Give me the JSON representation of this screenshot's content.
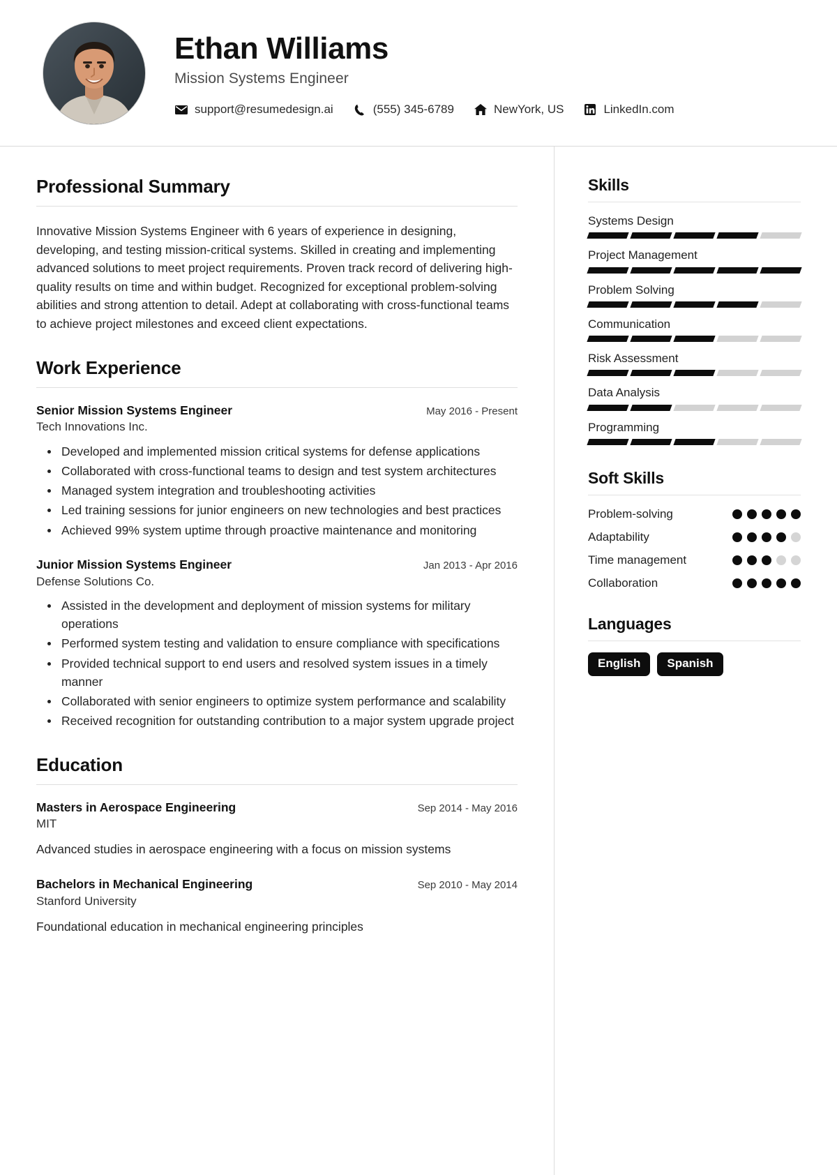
{
  "header": {
    "name": "Ethan Williams",
    "job_title": "Mission Systems Engineer",
    "avatar_alt": "profile-photo",
    "contacts": [
      {
        "icon": "envelope-icon",
        "value": "support@resumedesign.ai"
      },
      {
        "icon": "phone-icon",
        "value": "(555) 345-6789"
      },
      {
        "icon": "home-icon",
        "value": "NewYork, US"
      },
      {
        "icon": "linkedin-icon",
        "value": "LinkedIn.com"
      }
    ]
  },
  "main": {
    "summary": {
      "title": "Professional Summary",
      "text": "Innovative Mission Systems Engineer with 6 years of experience in designing, developing, and testing mission-critical systems. Skilled in creating and implementing advanced solutions to meet project requirements. Proven track record of delivering high-quality results on time and within budget. Recognized for exceptional problem-solving abilities and strong attention to detail. Adept at collaborating with cross-functional teams to achieve project milestones and exceed client expectations."
    },
    "work": {
      "title": "Work Experience",
      "entries": [
        {
          "role": "Senior Mission Systems Engineer",
          "date": "May 2016 - Present",
          "org": "Tech Innovations Inc.",
          "bullets": [
            "Developed and implemented mission critical systems for defense applications",
            "Collaborated with cross-functional teams to design and test system architectures",
            "Managed system integration and troubleshooting activities",
            "Led training sessions for junior engineers on new technologies and best practices",
            "Achieved 99% system uptime through proactive maintenance and monitoring"
          ]
        },
        {
          "role": "Junior Mission Systems Engineer",
          "date": "Jan 2013 - Apr 2016",
          "org": "Defense Solutions Co.",
          "bullets": [
            "Assisted in the development and deployment of mission systems for military operations",
            "Performed system testing and validation to ensure compliance with specifications",
            "Provided technical support to end users and resolved system issues in a timely manner",
            "Collaborated with senior engineers to optimize system performance and scalability",
            "Received recognition for outstanding contribution to a major system upgrade project"
          ]
        }
      ]
    },
    "education": {
      "title": "Education",
      "entries": [
        {
          "degree": "Masters in Aerospace Engineering",
          "date": "Sep 2014 - May 2016",
          "school": "MIT",
          "description": "Advanced studies in aerospace engineering with a focus on mission systems"
        },
        {
          "degree": "Bachelors in Mechanical Engineering",
          "date": "Sep 2010 - May 2014",
          "school": "Stanford University",
          "description": "Foundational education in mechanical engineering principles"
        }
      ]
    }
  },
  "sidebar": {
    "skills": {
      "title": "Skills",
      "max": 5,
      "items": [
        {
          "label": "Systems Design",
          "level": 4
        },
        {
          "label": "Project Management",
          "level": 5
        },
        {
          "label": "Problem Solving",
          "level": 4
        },
        {
          "label": "Communication",
          "level": 3
        },
        {
          "label": "Risk Assessment",
          "level": 3
        },
        {
          "label": "Data Analysis",
          "level": 2
        },
        {
          "label": "Programming",
          "level": 3
        }
      ]
    },
    "soft_skills": {
      "title": "Soft Skills",
      "max": 5,
      "items": [
        {
          "label": "Problem-solving",
          "level": 5
        },
        {
          "label": "Adaptability",
          "level": 4
        },
        {
          "label": "Time management",
          "level": 3
        },
        {
          "label": "Collaboration",
          "level": 5
        }
      ]
    },
    "languages": {
      "title": "Languages",
      "items": [
        "English",
        "Spanish"
      ]
    }
  },
  "colors": {
    "accent": "#0d0d0d",
    "muted_bar": "#d2d2d2",
    "text": "#1a1a1a",
    "divider": "#dcdcdc",
    "chip_bg": "#0d0d0d",
    "chip_text": "#ffffff"
  }
}
